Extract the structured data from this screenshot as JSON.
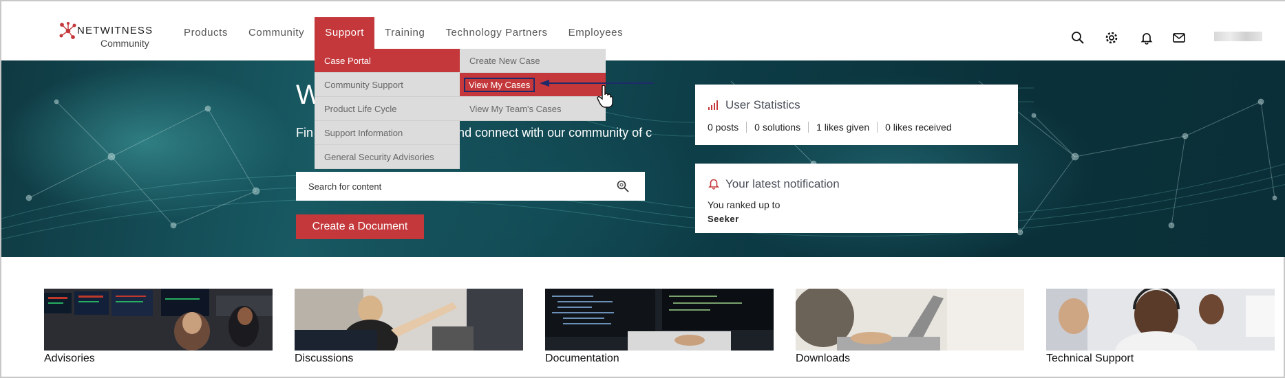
{
  "brand": {
    "name": "NETWITNESS",
    "sub": "Community"
  },
  "nav": [
    {
      "label": "Products",
      "active": false
    },
    {
      "label": "Community",
      "active": false
    },
    {
      "label": "Support",
      "active": true
    },
    {
      "label": "Training",
      "active": false
    },
    {
      "label": "Technology Partners",
      "active": false
    },
    {
      "label": "Employees",
      "active": false
    }
  ],
  "header_icons": [
    "search-icon",
    "gear-icon",
    "bell-icon",
    "mail-icon"
  ],
  "dropdown": {
    "col1": [
      "Case Portal",
      "Community Support",
      "Product Life Cycle",
      "Support Information",
      "General Security Advisories"
    ],
    "col2": [
      "Create New Case",
      "View My Cases",
      "View My Team's Cases"
    ]
  },
  "hero": {
    "title": "W",
    "text": "Fin                                        and connect with our community of c",
    "search_placeholder": "Search for content",
    "create_label": "Create a Document"
  },
  "stats": {
    "title": "User Statistics",
    "items": [
      "0 posts",
      "0 solutions",
      "1 likes given",
      "0 likes received"
    ]
  },
  "notification": {
    "title": "Your latest notification",
    "line1": "You ranked up to",
    "line2": "Seeker"
  },
  "tiles": [
    "Advisories",
    "Discussions",
    "Documentation",
    "Downloads",
    "Technical Support"
  ],
  "colors": {
    "accent": "#c4373a",
    "hero": "#0f3942",
    "annotation": "#1f2a6b"
  }
}
